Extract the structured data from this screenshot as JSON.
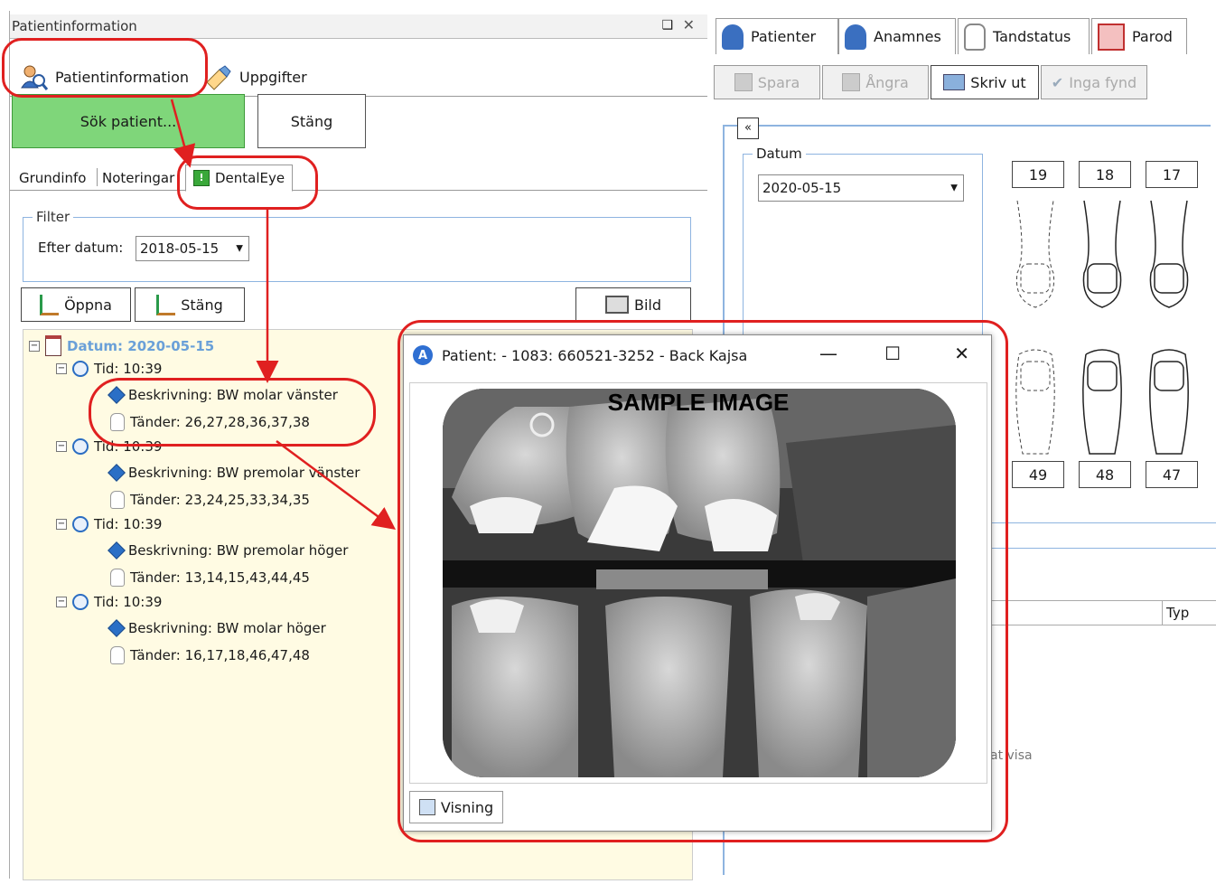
{
  "left_panel": {
    "title": "Patientinformation",
    "pin_glyph": "❑",
    "close_glyph": "✕",
    "top_tabs": [
      {
        "label": "Patientinformation",
        "icon": "patient-info-icon"
      },
      {
        "label": "Uppgifter",
        "icon": "tasks-icon"
      }
    ],
    "search_button": "Sök patient...",
    "close_button": "Stäng",
    "sub_tabs": [
      "Grundinfo",
      "Noteringar",
      "DentalEye"
    ],
    "filter": {
      "legend": "Filter",
      "label": "Efter datum:",
      "value": "2018-05-15"
    },
    "toolbar": {
      "open": "Öppna",
      "close": "Stäng",
      "image": "Bild"
    },
    "tree": {
      "date": "Datum: 2020-05-15",
      "entries": [
        {
          "time": "Tid: 10:39",
          "desc": "Beskrivning: BW molar vänster",
          "teeth": "Tänder: 26,27,28,36,37,38"
        },
        {
          "time": "Tid: 10:39",
          "desc": "Beskrivning: BW premolar vänster",
          "teeth": "Tänder: 23,24,25,33,34,35"
        },
        {
          "time": "Tid: 10:39",
          "desc": "Beskrivning: BW premolar höger",
          "teeth": "Tänder: 13,14,15,43,44,45"
        },
        {
          "time": "Tid: 10:39",
          "desc": "Beskrivning: BW molar höger",
          "teeth": "Tänder: 16,17,18,46,47,48"
        }
      ]
    }
  },
  "right_panel": {
    "tabs": [
      "Patienter",
      "Anamnes",
      "Tandstatus",
      "Parod"
    ],
    "toolbar": [
      "Spara",
      "Ångra",
      "Skriv ut",
      "Inga fynd"
    ],
    "collapse_glyph": "«",
    "datum_label": "Datum",
    "datum_value": "2020-05-15",
    "upper_teeth": [
      "19",
      "18",
      "17"
    ],
    "lower_teeth": [
      "49",
      "48",
      "47"
    ],
    "column_header": "Typ",
    "partial_text": "at visa"
  },
  "popup": {
    "title": "Patient:  - 1083: 660521-3252 - Back Kajsa",
    "app_letter": "A",
    "minimize": "—",
    "maximize": "☐",
    "close": "✕",
    "watermark": "SAMPLE IMAGE",
    "view_button": "Visning"
  },
  "colors": {
    "annotation_red": "#e02020",
    "green_button": "#7fd67a",
    "tree_background": "#fffbe3",
    "date_blue": "#6aa0d8"
  }
}
